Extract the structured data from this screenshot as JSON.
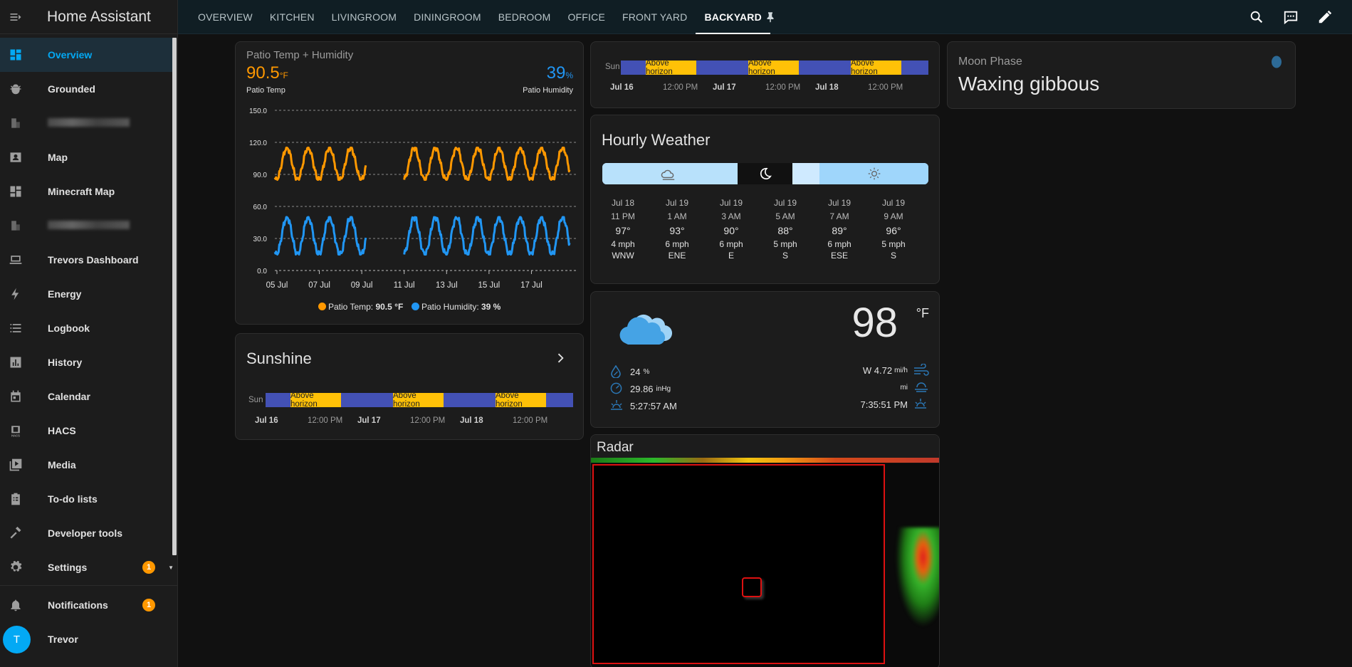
{
  "app_title": "Home Assistant",
  "sidebar": {
    "items": [
      {
        "label": "Overview",
        "icon": "dashboard-icon",
        "selected": true
      },
      {
        "label": "Grounded",
        "icon": "bug-icon"
      },
      {
        "label": "",
        "icon": "blurred-icon",
        "blurred": true
      },
      {
        "label": "Map",
        "icon": "map-account-icon"
      },
      {
        "label": "Minecraft Map",
        "icon": "dashboard-icon"
      },
      {
        "label": "",
        "icon": "blurred-icon",
        "blurred": true
      },
      {
        "label": "Trevors Dashboard",
        "icon": "laptop-icon"
      },
      {
        "label": "Energy",
        "icon": "lightning-bolt-icon"
      },
      {
        "label": "Logbook",
        "icon": "format-list-icon"
      },
      {
        "label": "History",
        "icon": "chart-box-icon"
      },
      {
        "label": "Calendar",
        "icon": "calendar-icon"
      },
      {
        "label": "HACS",
        "icon": "hacs-icon"
      },
      {
        "label": "Media",
        "icon": "play-box-multiple-icon"
      },
      {
        "label": "To-do lists",
        "icon": "clipboard-list-icon"
      },
      {
        "label": "Developer tools",
        "icon": "hammer-icon"
      },
      {
        "label": "Settings",
        "icon": "cog-icon",
        "badge": "1"
      }
    ],
    "notifications": {
      "label": "Notifications",
      "badge": "1"
    },
    "user": {
      "label": "Trevor",
      "initial": "T"
    }
  },
  "tabs": [
    "OVERVIEW",
    "KITCHEN",
    "LIVINGROOM",
    "DININGROOM",
    "BEDROOM",
    "OFFICE",
    "FRONT YARD",
    "BACKYARD"
  ],
  "active_tab": "BACKYARD",
  "patio": {
    "title": "Patio Temp + Humidity",
    "temp_value": "90.5",
    "temp_unit": "°F",
    "temp_label": "Patio Temp",
    "hum_value": "39",
    "hum_unit": "%",
    "hum_label": "Patio Humidity",
    "legend_temp": "Patio Temp: ",
    "legend_temp_value": "90.5 °F",
    "legend_hum": "Patio Humidity: ",
    "legend_hum_value": "39 %"
  },
  "chart_data": {
    "type": "line",
    "title": "Patio Temp + Humidity",
    "x": [
      "05 Jul",
      "07 Jul",
      "09 Jul",
      "11 Jul",
      "13 Jul",
      "15 Jul",
      "17 Jul"
    ],
    "yticks": [
      "150.0",
      "120.0",
      "90.0",
      "60.0",
      "30.0",
      "0.0"
    ],
    "ylim": [
      0,
      150
    ],
    "grid": true,
    "legend": "bottom",
    "colors": {
      "temp": "#ff9800",
      "humidity": "#2196f3"
    },
    "series": [
      {
        "name": "Patio Temp",
        "unit": "°F",
        "min": 85,
        "max": 115,
        "segments": [
          [
            4.9,
            9.2
          ],
          [
            11.0,
            18.8
          ]
        ]
      },
      {
        "name": "Patio Humidity",
        "unit": "%",
        "min": 15,
        "max": 50,
        "segments": [
          [
            4.9,
            9.2
          ],
          [
            11.0,
            18.8
          ]
        ]
      }
    ]
  },
  "sunshine": {
    "title": "Sunshine",
    "row_label": "Sun",
    "segment_label": "Above horizon",
    "ticks": [
      "Jul 16",
      "12:00 PM",
      "Jul 17",
      "12:00 PM",
      "Jul 18",
      "12:00 PM"
    ]
  },
  "top_sun": {
    "row_label": "Sun",
    "segment_label": "Above horizon",
    "ticks": [
      "Jul 16",
      "12:00 PM",
      "Jul 17",
      "12:00 PM",
      "Jul 18",
      "12:00 PM"
    ]
  },
  "hourly": {
    "title": "Hourly Weather",
    "columns": [
      {
        "date": "Jul 18",
        "time": "11 PM",
        "temp": "97°",
        "speed": "4 mph",
        "dir": "WNW"
      },
      {
        "date": "Jul 19",
        "time": "1 AM",
        "temp": "93°",
        "speed": "6 mph",
        "dir": "ENE"
      },
      {
        "date": "Jul 19",
        "time": "3 AM",
        "temp": "90°",
        "speed": "6 mph",
        "dir": "E"
      },
      {
        "date": "Jul 19",
        "time": "5 AM",
        "temp": "88°",
        "speed": "5 mph",
        "dir": "S"
      },
      {
        "date": "Jul 19",
        "time": "7 AM",
        "temp": "89°",
        "speed": "6 mph",
        "dir": "ESE"
      },
      {
        "date": "Jul 19",
        "time": "9 AM",
        "temp": "96°",
        "speed": "5 mph",
        "dir": "S"
      }
    ]
  },
  "current_weather": {
    "temp": "98",
    "unit": "°F",
    "humidity": "24",
    "humidity_unit": "%",
    "pressure": "29.86",
    "pressure_unit": "inHg",
    "sunrise": "5:27:57 AM",
    "wind": "W 4.72",
    "wind_unit": "mi/h",
    "visibility_unit": "mi",
    "sunset": "7:35:51 PM"
  },
  "moon": {
    "title": "Moon Phase",
    "value": "Waxing gibbous"
  },
  "radar": {
    "title": "Radar"
  }
}
